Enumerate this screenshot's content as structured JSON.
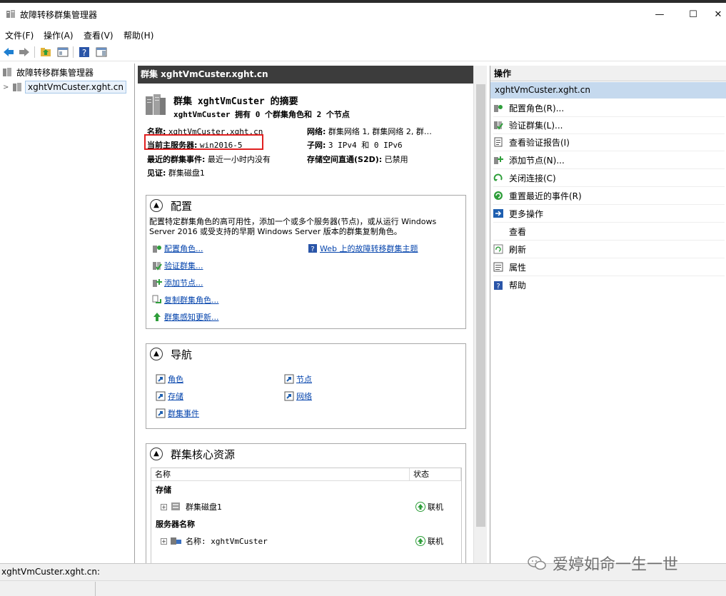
{
  "window": {
    "title": "故障转移群集管理器",
    "minimize": "—",
    "maximize": "☐",
    "close": "✕"
  },
  "menu": [
    "文件(F)",
    "操作(A)",
    "查看(V)",
    "帮助(H)"
  ],
  "tree": {
    "root": "故障转移群集管理器",
    "cluster": "xghtVmCuster.xght.cn"
  },
  "center": {
    "header": "群集 xghtVmCuster.xght.cn",
    "summary_title": "群集 xghtVmCuster 的摘要",
    "summary_sub": "xghtVmCuster 拥有 0 个群集角色和 2 个节点",
    "info": {
      "name_label": "名称:",
      "name_value": "xghtVmCuster.xght.cn",
      "host_label": "当前主服务器:",
      "host_value": "win2016-5",
      "events_label": "最近的群集事件:",
      "events_value": "最近一小时内没有",
      "witness_label": "见证:",
      "witness_value": "群集磁盘1",
      "network_label": "网络:",
      "network_value": "群集网络 1, 群集网络 2, 群…",
      "subnet_label": "子网:",
      "subnet_value": "3 IPv4 和 0 IPv6",
      "s2d_label": "存储空间直通(S2D):",
      "s2d_value": "已禁用"
    },
    "config": {
      "title": "配置",
      "desc_line1": "配置特定群集角色的高可用性，添加一个或多个服务器(节点)，或从运行 Windows",
      "desc_line2": "Server 2016 或受支持的早期 Windows Server 版本的群集复制角色。",
      "links": [
        "配置角色...",
        "验证群集...",
        "添加节点...",
        "复制群集角色...",
        "群集感知更新..."
      ],
      "web_link": "Web 上的故障转移群集主题"
    },
    "nav": {
      "title": "导航",
      "links": [
        "角色",
        "节点",
        "存储",
        "网络",
        "群集事件"
      ]
    },
    "core": {
      "title": "群集核心资源",
      "col_name": "名称",
      "col_status": "状态",
      "group_storage": "存储",
      "disk": "群集磁盘1",
      "disk_status": "联机",
      "group_server": "服务器名称",
      "server": "名称: xghtVmCuster",
      "server_status": "联机"
    }
  },
  "actions": {
    "header": "操作",
    "sub": "xghtVmCuster.xght.cn",
    "items": [
      "配置角色(R)...",
      "验证群集(L)...",
      "查看验证报告(I)",
      "添加节点(N)...",
      "关闭连接(C)",
      "重置最近的事件(R)",
      "更多操作",
      "查看",
      "刷新",
      "属性",
      "帮助"
    ]
  },
  "statusbar": {
    "text": "xghtVmCuster.xght.cn:"
  },
  "watermark": "爱婷如命一生一世",
  "colors": {
    "header_dark": "#3c3c3c",
    "selection": "#c5d9ee",
    "link": "#0645ad",
    "highlight_box": "#e02020",
    "online": "#2e9e3a"
  }
}
